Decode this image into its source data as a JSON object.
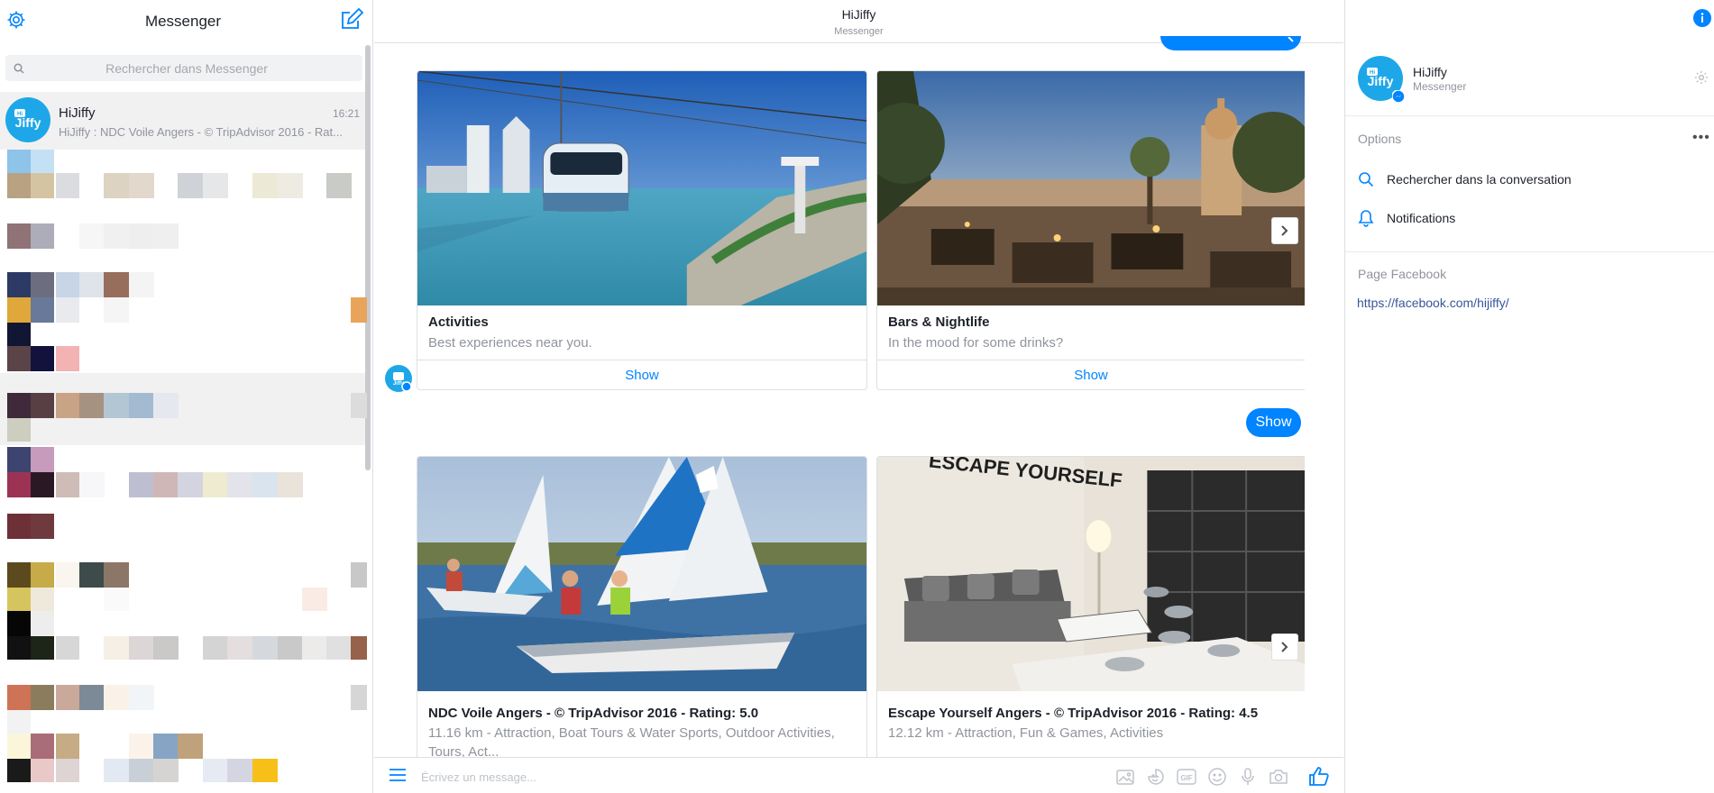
{
  "sidebar": {
    "title": "Messenger",
    "search_placeholder": "Rechercher dans Messenger",
    "active_conversation": {
      "name": "HiJiffy",
      "time": "16:21",
      "snippet": "HiJiffy : NDC Voile Angers - © TripAdvisor 2016 - Rat...",
      "avatar_text": "Jiffy"
    }
  },
  "conversation": {
    "title": "HiJiffy",
    "subtitle": "Messenger",
    "carousel_1": [
      {
        "title": "Activities",
        "subtitle": "Best experiences near you.",
        "button": "Show"
      },
      {
        "title": "Bars & Nightlife",
        "subtitle": "In the mood for some drinks?",
        "button": "Show"
      }
    ],
    "user_reply": "Show",
    "carousel_2": [
      {
        "title": "NDC Voile Angers - © TripAdvisor 2016 - Rating: 5.0",
        "subtitle": "11.16 km - Attraction, Boat Tours & Water Sports, Outdoor Activities, Tours, Act..."
      },
      {
        "title": "Escape Yourself Angers - © TripAdvisor 2016 - Rating: 4.5",
        "subtitle": "12.12 km - Attraction, Fun & Games, Activities",
        "image_text": "ESCAPE YOURSELF"
      }
    ],
    "composer_placeholder": "Écrivez un message...",
    "composer_icons": [
      "image-icon",
      "sticker-icon",
      "gif-icon",
      "emoji-icon",
      "microphone-icon",
      "camera-icon",
      "thumbs-up-icon"
    ]
  },
  "details": {
    "name": "HiJiffy",
    "subtitle": "Messenger",
    "options_label": "Options",
    "more_label": "•••",
    "options": [
      {
        "icon": "search-icon",
        "label": "Rechercher dans la conversation"
      },
      {
        "icon": "bell-icon",
        "label": "Notifications"
      }
    ],
    "facebook_page_label": "Page Facebook",
    "facebook_page_url": "https://facebook.com/hijiffy/"
  },
  "colors": {
    "accent": "#0084ff",
    "brand_avatar": "#1ea7e8",
    "link": "#365899"
  }
}
